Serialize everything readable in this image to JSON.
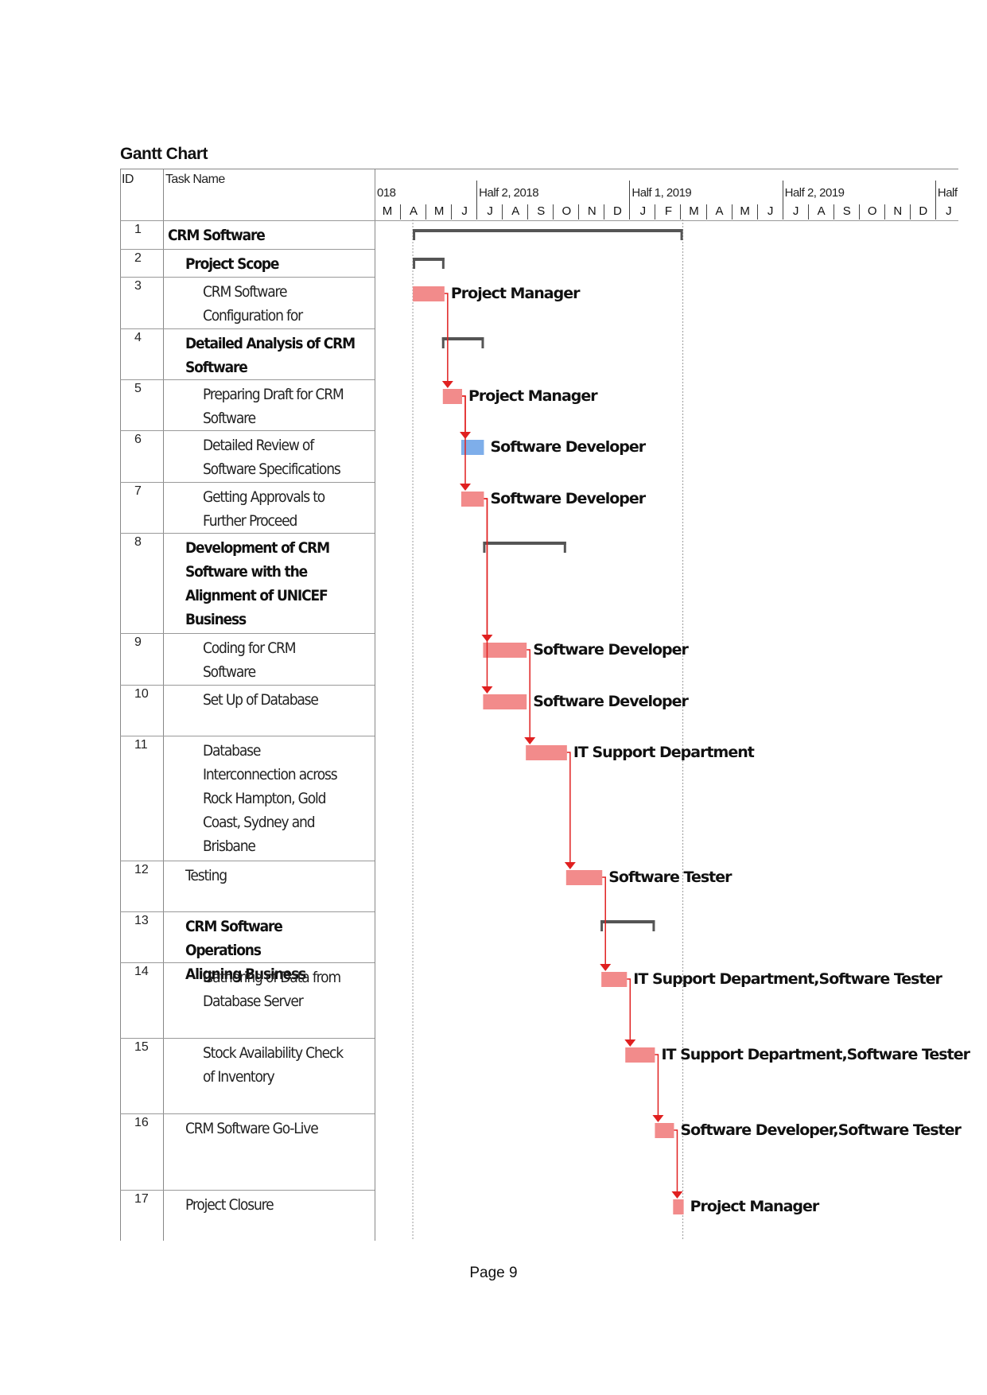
{
  "document": {
    "title": "Gantt Chart",
    "page_label": "Page 9"
  },
  "table": {
    "headers": {
      "id": "ID",
      "task_name": "Task Name"
    },
    "rows": [
      {
        "id": "1",
        "name": "CRM Software",
        "level": 0,
        "summary": true
      },
      {
        "id": "2",
        "name": "Project Scope",
        "level": 1,
        "summary": true
      },
      {
        "id": "3",
        "name": "CRM Software\nConfiguration for",
        "level": 2,
        "summary": false
      },
      {
        "id": "4",
        "name": "Detailed Analysis of CRM\nSoftware",
        "level": 1,
        "summary": true
      },
      {
        "id": "5",
        "name": "Preparing Draft for CRM\nSoftware",
        "level": 2,
        "summary": false
      },
      {
        "id": "6",
        "name": "Detailed Review of\nSoftware Specifications",
        "level": 2,
        "summary": false
      },
      {
        "id": "7",
        "name": "Getting Approvals to\nFurther Proceed",
        "level": 2,
        "summary": false
      },
      {
        "id": "8",
        "name": "Development of CRM\nSoftware with the\nAlignment of UNICEF\nBusiness",
        "level": 1,
        "summary": true
      },
      {
        "id": "9",
        "name": "Coding for CRM\nSoftware",
        "level": 2,
        "summary": false
      },
      {
        "id": "10",
        "name": "Set Up of Database",
        "level": 2,
        "summary": false
      },
      {
        "id": "11",
        "name": "Database\nInterconnection across\nRock Hampton, Gold\nCoast, Sydney and\nBrisbane",
        "level": 2,
        "summary": false
      },
      {
        "id": "12",
        "name": "Testing",
        "level": 1,
        "summary": false
      },
      {
        "id": "13",
        "name": "CRM Software Operations\nAligning Business",
        "level": 1,
        "summary": true
      },
      {
        "id": "14",
        "name": "Gathering of Data from\nDatabase Server",
        "level": 2,
        "summary": false
      },
      {
        "id": "15",
        "name": "Stock Availability Check\nof Inventory",
        "level": 2,
        "summary": false
      },
      {
        "id": "16",
        "name": "CRM Software Go-Live",
        "level": 1,
        "summary": false
      },
      {
        "id": "17",
        "name": "Project Closure",
        "level": 1,
        "summary": false
      }
    ]
  },
  "chart_data": {
    "type": "gantt",
    "timescale": {
      "top_tier": [
        "018",
        "Half 2, 2018",
        "Half 1, 2019",
        "Half 2, 2019",
        "Half"
      ],
      "months": [
        "M",
        "A",
        "M",
        "J",
        "J",
        "A",
        "S",
        "O",
        "N",
        "D",
        "J",
        "F",
        "M",
        "A",
        "M",
        "J",
        "J",
        "A",
        "S",
        "O",
        "N",
        "D",
        "J"
      ]
    },
    "colors": {
      "task": "#F28B8B",
      "critical_highlight": "#7EAEEA",
      "summary": "#555555",
      "link": "#E02020"
    },
    "tasks": [
      {
        "id": "1",
        "start": "2018-04-16",
        "finish": "2019-03-04",
        "type": "summary",
        "resource": ""
      },
      {
        "id": "2",
        "start": "2018-04-16",
        "finish": "2018-05-24",
        "type": "summary",
        "resource": ""
      },
      {
        "id": "3",
        "start": "2018-04-16",
        "finish": "2018-05-24",
        "type": "task",
        "resource": "Project Manager",
        "predecessors": []
      },
      {
        "id": "4",
        "start": "2018-05-21",
        "finish": "2018-07-10",
        "type": "summary",
        "resource": ""
      },
      {
        "id": "5",
        "start": "2018-05-22",
        "finish": "2018-06-14",
        "type": "task",
        "resource": "Project Manager",
        "predecessors": [
          "3"
        ]
      },
      {
        "id": "6",
        "start": "2018-06-13",
        "finish": "2018-07-10",
        "type": "task",
        "resource": "Software Developer",
        "predecessors": [
          "5"
        ],
        "highlight": true
      },
      {
        "id": "7",
        "start": "2018-06-13",
        "finish": "2018-07-10",
        "type": "task",
        "resource": "Software Developer",
        "predecessors": [
          "5"
        ]
      },
      {
        "id": "8",
        "start": "2018-07-09",
        "finish": "2018-10-17",
        "type": "summary",
        "resource": ""
      },
      {
        "id": "9",
        "start": "2018-07-09",
        "finish": "2018-08-31",
        "type": "task",
        "resource": "Software Developer",
        "predecessors": [
          "7"
        ]
      },
      {
        "id": "10",
        "start": "2018-07-09",
        "finish": "2018-08-31",
        "type": "task",
        "resource": "Software Developer",
        "predecessors": [
          "7"
        ]
      },
      {
        "id": "11",
        "start": "2018-08-30",
        "finish": "2018-10-18",
        "type": "task",
        "resource": "IT Support Department",
        "predecessors": [
          "9"
        ]
      },
      {
        "id": "12",
        "start": "2018-10-17",
        "finish": "2018-11-29",
        "type": "task",
        "resource": "Software Tester",
        "predecessors": [
          "11"
        ]
      },
      {
        "id": "13",
        "start": "2018-11-27",
        "finish": "2019-02-01",
        "type": "summary",
        "resource": ""
      },
      {
        "id": "14",
        "start": "2018-11-28",
        "finish": "2018-12-29",
        "type": "task",
        "resource": "IT Support Department,Software Tester",
        "predecessors": [
          "12"
        ]
      },
      {
        "id": "15",
        "start": "2018-12-27",
        "finish": "2019-02-01",
        "type": "task",
        "resource": "IT Support Department,Software Tester",
        "predecessors": [
          "14"
        ]
      },
      {
        "id": "16",
        "start": "2019-02-01",
        "finish": "2019-02-22",
        "type": "task",
        "resource": "Software Developer,Software Tester",
        "predecessors": [
          "15"
        ]
      },
      {
        "id": "17",
        "start": "2019-02-21",
        "finish": "2019-03-05",
        "type": "task",
        "resource": "Project Manager",
        "predecessors": [
          "16"
        ]
      }
    ]
  }
}
